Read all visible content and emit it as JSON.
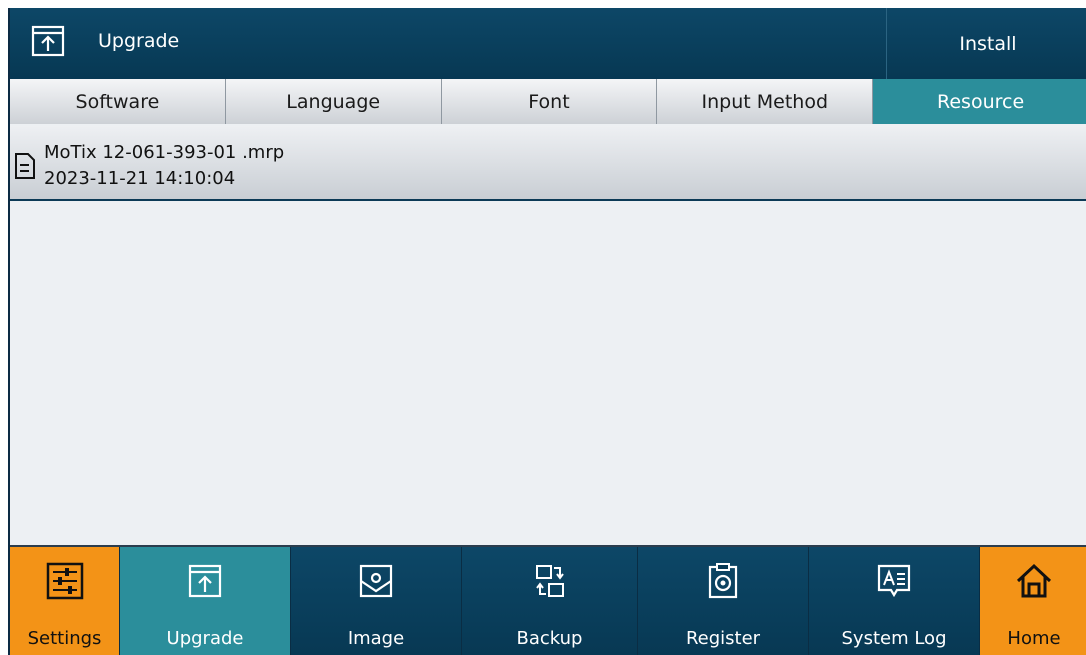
{
  "header": {
    "title": "Upgrade",
    "install_label": "Install",
    "icon": "upload-box-icon"
  },
  "tabs": [
    {
      "label": "Software",
      "active": false
    },
    {
      "label": "Language",
      "active": false
    },
    {
      "label": "Font",
      "active": false
    },
    {
      "label": "Input Method",
      "active": false
    },
    {
      "label": "Resource",
      "active": true
    }
  ],
  "files": [
    {
      "name": "MoTix 12-061-393-01 .mrp",
      "date": "2023-11-21 14:10:04",
      "icon": "document-icon"
    }
  ],
  "nav": [
    {
      "label": "Settings",
      "icon": "sliders-icon",
      "state": "orange"
    },
    {
      "label": "Upgrade",
      "icon": "upload-box-icon",
      "state": "active"
    },
    {
      "label": "Image",
      "icon": "image-tag-icon",
      "state": "normal"
    },
    {
      "label": "Backup",
      "icon": "backup-icon",
      "state": "normal"
    },
    {
      "label": "Register",
      "icon": "register-clipboard-icon",
      "state": "normal"
    },
    {
      "label": "System Log",
      "icon": "system-log-icon",
      "state": "normal"
    },
    {
      "label": "Home",
      "icon": "home-icon",
      "state": "orange"
    }
  ],
  "colors": {
    "header_bg": "#0a4060",
    "accent_teal": "#2b8e9b",
    "accent_orange": "#f39317"
  }
}
